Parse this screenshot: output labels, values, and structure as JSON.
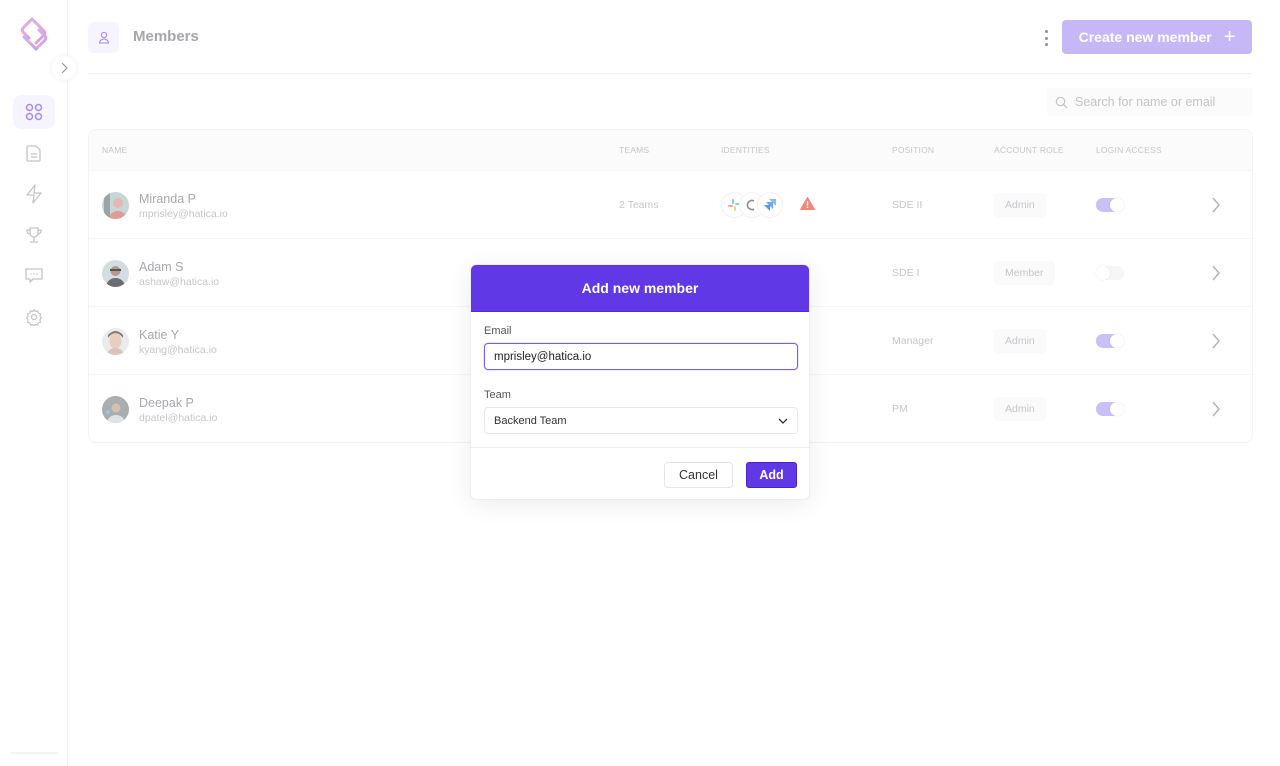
{
  "header": {
    "title": "Members",
    "create_button_label": "Create new member",
    "create_button_icon": "plus-icon"
  },
  "sidebar": {
    "items": [
      {
        "name": "dashboard",
        "icon": "grid-icon",
        "active": true
      },
      {
        "name": "reports",
        "icon": "document-icon",
        "active": false
      },
      {
        "name": "activity",
        "icon": "lightning-icon",
        "active": false
      },
      {
        "name": "goals",
        "icon": "trophy-icon",
        "active": false
      },
      {
        "name": "messages",
        "icon": "chat-icon",
        "active": false
      },
      {
        "name": "settings",
        "icon": "gear-icon",
        "active": false
      }
    ]
  },
  "search": {
    "placeholder": "Search for name or email",
    "value": ""
  },
  "table": {
    "columns": [
      "Name",
      "Teams",
      "Identities",
      "Position",
      "Account role",
      "Login access"
    ],
    "rows": [
      {
        "name": "Miranda P",
        "email": "mprisley@hatica.io",
        "teams": "2 Teams",
        "identities": [
          "slack",
          "github",
          "jira"
        ],
        "warning": true,
        "position": "SDE II",
        "role": "Admin",
        "login_access": true
      },
      {
        "name": "Adam S",
        "email": "ashaw@hatica.io",
        "teams": "",
        "identities": [],
        "warning": false,
        "position": "SDE I",
        "role": "Member",
        "login_access": false
      },
      {
        "name": "Katie Y",
        "email": "kyang@hatica.io",
        "teams": "",
        "identities": [],
        "warning": false,
        "position": "Manager",
        "role": "Admin",
        "login_access": true
      },
      {
        "name": "Deepak P",
        "email": "dpatel@hatica.io",
        "teams": "",
        "identities": [],
        "warning": false,
        "position": "PM",
        "role": "Admin",
        "login_access": true
      }
    ]
  },
  "modal": {
    "title": "Add new member",
    "email_label": "Email",
    "email_value": "mprisley@hatica.io",
    "team_label": "Team",
    "team_selected": "Backend Team",
    "cancel_label": "Cancel",
    "add_label": "Add"
  },
  "colors": {
    "accent": "#6138e6",
    "accent_light": "#c6b8f6",
    "toggle_on": "#cbbff7",
    "warning": "#f0887a"
  }
}
